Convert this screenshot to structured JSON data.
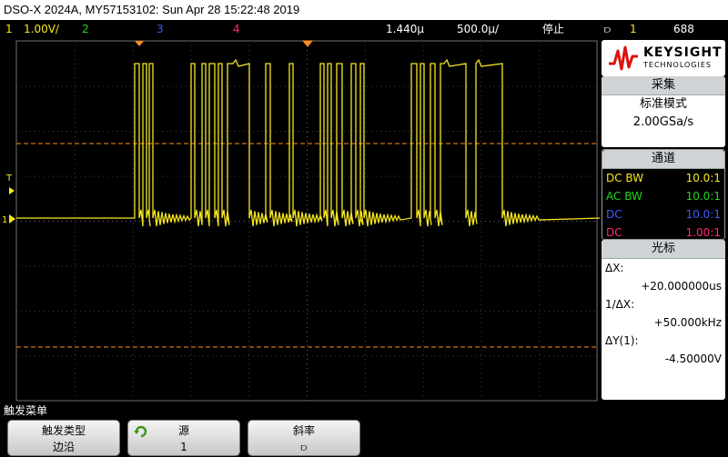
{
  "title": "DSO-X 2024A, MY57153102: Sun Apr 28 15:22:48 2019",
  "status": {
    "ch1_num": "1",
    "ch1_scale": "1.00V/",
    "ch2_num": "2",
    "ch3_num": "3",
    "ch4_num": "4",
    "delay": "1.440µ",
    "timebase": "500.0µ/",
    "run_state": "停止",
    "trig_icon": "⫐",
    "trig_src": "1",
    "trig_level": "688"
  },
  "colors": {
    "ch1": "#f5e61e",
    "ch2": "#22d61c",
    "ch3": "#3f5bff",
    "ch4": "#ff2f6e",
    "orange": "#ff8c1a"
  },
  "markers": {
    "ground_label": "1",
    "trigger_label": "T"
  },
  "logo": {
    "brand": "KEYSIGHT",
    "sub": "TECHNOLOGIES"
  },
  "acquire": {
    "header": "采集",
    "mode": "标准模式",
    "rate": "2.00GSa/s"
  },
  "channels": {
    "header": "通道",
    "rows": [
      {
        "coupling": "DC BW",
        "probe": "10.0:1"
      },
      {
        "coupling": "AC BW",
        "probe": "10.0:1"
      },
      {
        "coupling": "DC",
        "probe": "10.0:1"
      },
      {
        "coupling": "DC",
        "probe": "1.00:1"
      }
    ]
  },
  "cursors": {
    "header": "光标",
    "dx_label": "ΔX:",
    "dx_value": "+20.000000us",
    "inv_label": "1/ΔX:",
    "inv_value": "+50.000kHz",
    "dy_label": "ΔY(1):",
    "dy_value": "-4.50000V"
  },
  "menu": {
    "title": "触发菜单",
    "softkeys": [
      {
        "label": "触发类型",
        "value": "边沿"
      },
      {
        "label": "源",
        "value": "1"
      },
      {
        "label": "斜率",
        "value": "⫐"
      }
    ]
  },
  "waveform": {
    "segments": [
      {
        "t": 0,
        "level": "low"
      },
      {
        "t": 148,
        "level": "high"
      },
      {
        "t": 153,
        "level": "low"
      },
      {
        "t": 157,
        "level": "high"
      },
      {
        "t": 161,
        "level": "low"
      },
      {
        "t": 164,
        "level": "high"
      },
      {
        "t": 168,
        "level": "low"
      },
      {
        "t": 210,
        "level": "high"
      },
      {
        "t": 214,
        "level": "low"
      },
      {
        "t": 222,
        "level": "high"
      },
      {
        "t": 226,
        "level": "low"
      },
      {
        "t": 230,
        "level": "high"
      },
      {
        "t": 236,
        "level": "low"
      },
      {
        "t": 240,
        "level": "high"
      },
      {
        "t": 244,
        "level": "low"
      },
      {
        "t": 250,
        "level": "high"
      },
      {
        "t": 256,
        "level": "high"
      },
      {
        "t": 274,
        "level": "low"
      },
      {
        "t": 292,
        "level": "high"
      },
      {
        "t": 297,
        "level": "low"
      },
      {
        "t": 318,
        "level": "high"
      },
      {
        "t": 322,
        "level": "low"
      },
      {
        "t": 352,
        "level": "high"
      },
      {
        "t": 356,
        "level": "low"
      },
      {
        "t": 360,
        "level": "high"
      },
      {
        "t": 364,
        "level": "low"
      },
      {
        "t": 370,
        "level": "high"
      },
      {
        "t": 376,
        "level": "low"
      },
      {
        "t": 386,
        "level": "high"
      },
      {
        "t": 391,
        "level": "low"
      },
      {
        "t": 396,
        "level": "high"
      },
      {
        "t": 400,
        "level": "low"
      },
      {
        "t": 452,
        "level": "high"
      },
      {
        "t": 458,
        "level": "low"
      },
      {
        "t": 462,
        "level": "high"
      },
      {
        "t": 466,
        "level": "low"
      },
      {
        "t": 473,
        "level": "high"
      },
      {
        "t": 478,
        "level": "low"
      },
      {
        "t": 484,
        "level": "high"
      },
      {
        "t": 488,
        "level": "high"
      },
      {
        "t": 512,
        "level": "low"
      },
      {
        "t": 523,
        "level": "high"
      },
      {
        "t": 552,
        "level": "low"
      },
      {
        "t": 659,
        "level": "low"
      }
    ]
  }
}
